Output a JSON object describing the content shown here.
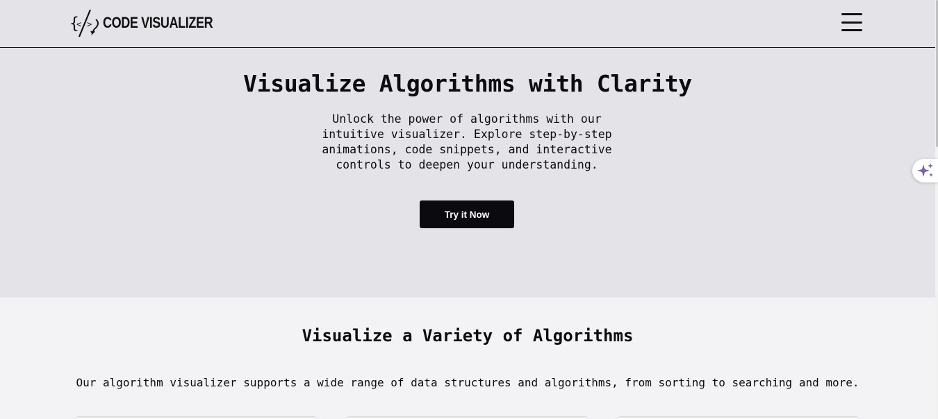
{
  "header": {
    "logo_text": "CODE VISUALIZER",
    "menu_icon": "hamburger-menu-icon"
  },
  "hero": {
    "title": "Visualize Algorithms with Clarity",
    "subtitle_lines": [
      "Unlock the power of algorithms with our",
      "intuitive visualizer. Explore step-by-step",
      "animations, code snippets, and interactive",
      "controls to deepen your understanding."
    ],
    "cta_label": "Try it Now"
  },
  "features": {
    "title": "Visualize a Variety of Algorithms",
    "description": "Our algorithm visualizer supports a wide range of data structures and algorithms, from sorting to searching and more."
  },
  "floating_assistant": {
    "icon": "sparkles-icon",
    "color": "#7b5ea7"
  },
  "colors": {
    "header_bg": "#e4e3e8",
    "section_bg": "#f3f3f5",
    "button_bg": "#0b0b0f"
  }
}
